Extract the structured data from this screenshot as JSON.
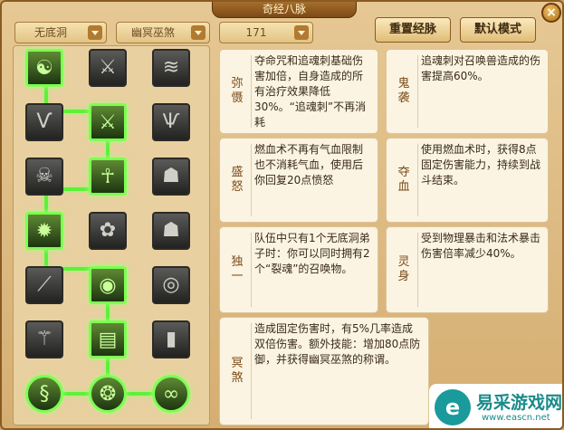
{
  "window": {
    "title": "奇经八脉",
    "close_label": "×"
  },
  "filters": [
    {
      "value": "无底洞"
    },
    {
      "value": "幽冥巫煞"
    },
    {
      "value": "171"
    }
  ],
  "buttons": {
    "reset": "重置经脉",
    "default": "默认模式"
  },
  "grid": {
    "rows": [
      [
        {
          "icon": "swirl-icon",
          "glyph": "☯",
          "active": true
        },
        {
          "icon": "blade-icon",
          "glyph": "⚔",
          "active": false
        },
        {
          "icon": "claw-icon",
          "glyph": "≋",
          "active": false
        }
      ],
      [
        {
          "icon": "horn-icon",
          "glyph": "Ѵ",
          "active": false
        },
        {
          "icon": "fighters-icon",
          "glyph": "⚔",
          "active": true
        },
        {
          "icon": "fang-icon",
          "glyph": "Ѱ",
          "active": false
        }
      ],
      [
        {
          "icon": "mask-icon",
          "glyph": "☠",
          "active": false
        },
        {
          "icon": "warrior-icon",
          "glyph": "☥",
          "active": true
        },
        {
          "icon": "demon-icon",
          "glyph": "☗",
          "active": false
        }
      ],
      [
        {
          "icon": "burst-icon",
          "glyph": "✹",
          "active": true
        },
        {
          "icon": "rose-icon",
          "glyph": "✿",
          "active": false
        },
        {
          "icon": "ghost-icon",
          "glyph": "☗",
          "active": false
        }
      ],
      [
        {
          "icon": "slash-icon",
          "glyph": "⟋",
          "active": false
        },
        {
          "icon": "orb-icon",
          "glyph": "◉",
          "active": true
        },
        {
          "icon": "spiral-icon",
          "glyph": "◎",
          "active": false
        }
      ],
      [
        {
          "icon": "claw-mark-icon",
          "glyph": "⚚",
          "active": false
        },
        {
          "icon": "scroll-icon",
          "glyph": "▤",
          "active": true
        },
        {
          "icon": "totem-icon",
          "glyph": "▮",
          "active": false
        }
      ],
      [
        {
          "icon": "serpent-icon",
          "glyph": "§",
          "active": true
        },
        {
          "icon": "vortex-icon",
          "glyph": "❂",
          "active": true
        },
        {
          "icon": "coil-icon",
          "glyph": "∞",
          "active": true
        }
      ]
    ]
  },
  "info_panels": [
    {
      "label": "弥慑",
      "text": "夺命咒和追魂刺基础伤害加倍，自身造成的所有治疗效果降低30%。“追魂刺”不再消耗"
    },
    {
      "label": "鬼袭",
      "text": "追魂刺对召唤兽造成的伤害提高60%。"
    },
    {
      "label": "盛怒",
      "text": "燃血术不再有气血限制也不消耗气血，使用后你回复20点愤怒"
    },
    {
      "label": "夺血",
      "text": "使用燃血术时，获得8点固定伤害能力，持续到战斗结束。"
    },
    {
      "label": "独一",
      "text": "队伍中只有1个无底洞弟子时：你可以同时拥有2个“裂魂”的召唤物。"
    },
    {
      "label": "灵身",
      "text": "受到物理暴击和法术暴击伤害倍率减少40%。"
    },
    {
      "label": "冥煞",
      "text": "造成固定伤害时，有5%几率造成双倍伤害。额外技能：增加80点防御，并获得幽冥巫煞的称谓。"
    }
  ],
  "watermark": {
    "logo": "e",
    "name": "易采游戏网",
    "url": "www.eascn.net"
  }
}
